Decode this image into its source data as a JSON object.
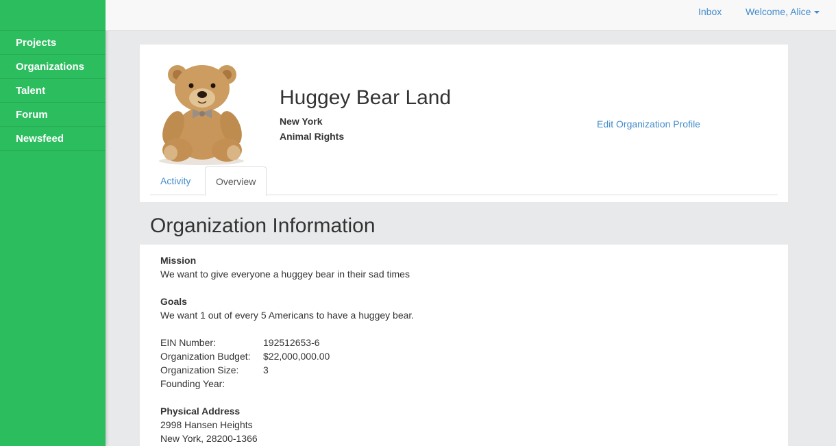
{
  "sidebar": {
    "items": [
      {
        "label": "Projects"
      },
      {
        "label": "Organizations"
      },
      {
        "label": "Talent"
      },
      {
        "label": "Forum"
      },
      {
        "label": "Newsfeed"
      }
    ]
  },
  "topbar": {
    "inbox_label": "Inbox",
    "welcome_label": "Welcome, Alice"
  },
  "org": {
    "name": "Huggey Bear Land",
    "location": "New York",
    "cause": "Animal Rights",
    "edit_label": "Edit Organization Profile",
    "avatar_icon": "teddy-bear-photo"
  },
  "tabs": [
    {
      "label": "Activity"
    },
    {
      "label": "Overview"
    }
  ],
  "info": {
    "title": "Organization Information",
    "mission_label": "Mission",
    "mission_text": "We want to give everyone a huggey bear in their sad times",
    "goals_label": "Goals",
    "goals_text": "We want 1 out of every 5 Americans to have a huggey bear.",
    "facts": [
      {
        "key": "EIN Number:",
        "value": "192512653-6"
      },
      {
        "key": "Organization Budget:",
        "value": "$22,000,000.00"
      },
      {
        "key": "Organization Size:",
        "value": "3"
      },
      {
        "key": "Founding Year:",
        "value": ""
      }
    ],
    "address_label": "Physical Address",
    "address_line1": "2998 Hansen Heights",
    "address_line2": "New York, 28200-1366"
  },
  "colors": {
    "sidebar": "#2bbd5e",
    "link": "#428bca",
    "background": "#e8e9ea"
  }
}
